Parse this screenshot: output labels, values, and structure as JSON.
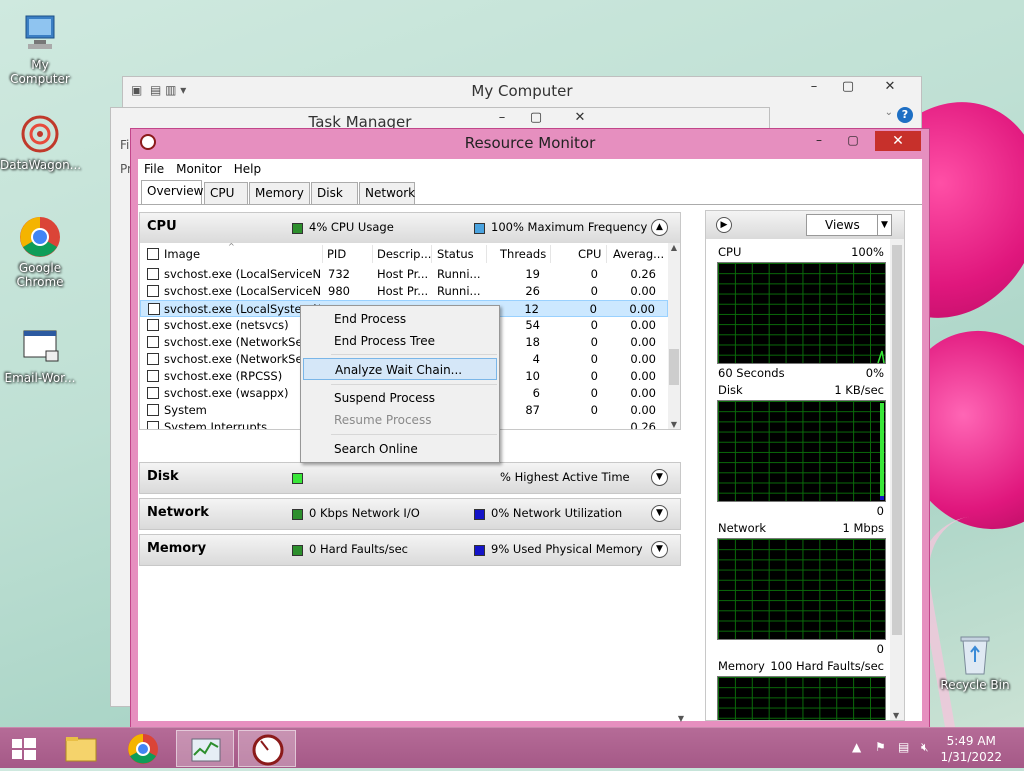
{
  "desktop": {
    "icons": [
      {
        "label": "My Computer"
      },
      {
        "label": "DataWagon..."
      },
      {
        "label": "Google Chrome"
      },
      {
        "label": "Email-Wor..."
      },
      {
        "label": "Recycle Bin"
      }
    ]
  },
  "my_computer_window": {
    "title": "My Computer"
  },
  "task_manager_window": {
    "title": "Task Manager",
    "menu_fragment": "Fil",
    "tab_fragment": "Pr"
  },
  "resource_monitor": {
    "title": "Resource Monitor",
    "menu": [
      "File",
      "Monitor",
      "Help"
    ],
    "tabs": [
      "Overview",
      "CPU",
      "Memory",
      "Disk",
      "Network"
    ],
    "active_tab": "Overview",
    "cpu_section": {
      "title": "CPU",
      "stat1": "4% CPU Usage",
      "stat2": "100% Maximum Frequency",
      "columns": [
        "Image",
        "PID",
        "Descrip...",
        "Status",
        "Threads",
        "CPU",
        "Averag..."
      ],
      "rows": [
        {
          "image": "svchost.exe (LocalServiceNet...",
          "pid": "732",
          "desc": "Host Pr...",
          "status": "Runni...",
          "threads": "19",
          "cpu": "0",
          "avg": "0.26"
        },
        {
          "image": "svchost.exe (LocalServiceNo...",
          "pid": "980",
          "desc": "Host Pr...",
          "status": "Runni...",
          "threads": "26",
          "cpu": "0",
          "avg": "0.00"
        },
        {
          "image": "svchost.exe (LocalSystemNe...",
          "pid": "",
          "desc": "",
          "status": "",
          "threads": "12",
          "cpu": "0",
          "avg": "0.00"
        },
        {
          "image": "svchost.exe (netsvcs)",
          "pid": "",
          "desc": "",
          "status": "",
          "threads": "54",
          "cpu": "0",
          "avg": "0.00"
        },
        {
          "image": "svchost.exe (NetworkService",
          "pid": "",
          "desc": "",
          "status": "",
          "threads": "18",
          "cpu": "0",
          "avg": "0.00"
        },
        {
          "image": "svchost.exe (NetworkService",
          "pid": "",
          "desc": "",
          "status": "",
          "threads": "4",
          "cpu": "0",
          "avg": "0.00"
        },
        {
          "image": "svchost.exe (RPCSS)",
          "pid": "",
          "desc": "",
          "status": "",
          "threads": "10",
          "cpu": "0",
          "avg": "0.00"
        },
        {
          "image": "svchost.exe (wsappx)",
          "pid": "",
          "desc": "",
          "status": "",
          "threads": "6",
          "cpu": "0",
          "avg": "0.00"
        },
        {
          "image": "System",
          "pid": "",
          "desc": "",
          "status": "",
          "threads": "87",
          "cpu": "0",
          "avg": "0.00"
        },
        {
          "image": "System Interrupts",
          "pid": "",
          "desc": "",
          "status": "",
          "threads": "",
          "cpu": "",
          "avg": "0.26"
        }
      ]
    },
    "disk_section": {
      "title": "Disk",
      "stat2": "% Highest Active Time"
    },
    "network_section": {
      "title": "Network",
      "stat1": "0 Kbps Network I/O",
      "stat2": "0% Network Utilization"
    },
    "memory_section": {
      "title": "Memory",
      "stat1": "0 Hard Faults/sec",
      "stat2": "9% Used Physical Memory"
    },
    "views_label": "Views",
    "graphs": {
      "cpu": {
        "title": "CPU",
        "max": "100%",
        "footer_left": "60 Seconds",
        "footer_right": "0%"
      },
      "disk": {
        "title": "Disk",
        "max": "1 KB/sec",
        "footer_right": "0"
      },
      "network": {
        "title": "Network",
        "max": "1 Mbps",
        "footer_right": "0"
      },
      "memory": {
        "title": "Memory",
        "max": "100 Hard Faults/sec"
      }
    }
  },
  "context_menu": {
    "items": [
      "End Process",
      "End Process Tree",
      "Analyze Wait Chain...",
      "Suspend Process",
      "Resume Process",
      "Search Online"
    ],
    "highlighted": "Analyze Wait Chain...",
    "disabled": "Resume Process"
  },
  "colors": {
    "cpu_green": "#2d8f2d",
    "disk_bright_green": "#39e639",
    "freq_blue": "#4aa3df",
    "util_blue": "#1414c8",
    "window_frame_pink": "#e68fbf",
    "close_red": "#c7302b"
  },
  "taskbar": {
    "time": "5:49 AM",
    "date": "1/31/2022"
  }
}
